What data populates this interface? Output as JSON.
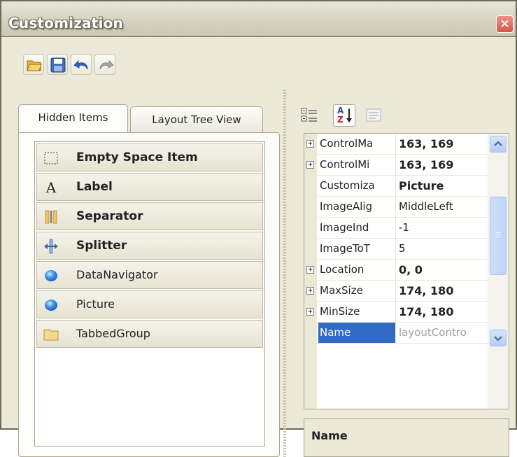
{
  "window": {
    "title": "Customization",
    "close_glyph": "×"
  },
  "toolbar": {
    "buttons": [
      {
        "name": "open-icon"
      },
      {
        "name": "save-icon"
      },
      {
        "name": "undo-icon"
      },
      {
        "name": "redo-icon"
      }
    ]
  },
  "tabs": [
    {
      "label": "Hidden Items",
      "active": true
    },
    {
      "label": "Layout Tree View",
      "active": false
    }
  ],
  "hidden_items": [
    {
      "label": "Empty Space Item",
      "icon": "empty-space-icon",
      "bold": true
    },
    {
      "label": "Label",
      "icon": "label-icon",
      "bold": true
    },
    {
      "label": "Separator",
      "icon": "separator-icon",
      "bold": true
    },
    {
      "label": "Splitter",
      "icon": "splitter-icon",
      "bold": true
    },
    {
      "label": "DataNavigator",
      "icon": "control-icon",
      "bold": false
    },
    {
      "label": "Picture",
      "icon": "control-icon",
      "bold": false
    },
    {
      "label": "TabbedGroup",
      "icon": "folder-icon",
      "bold": false
    }
  ],
  "label_glyph": "A",
  "property_toolbar": {
    "categorized": "categorized-icon",
    "alphabetical": "alphabetical-sort-icon",
    "property_pages": "property-pages-icon",
    "sort_letters_top": "A",
    "sort_letters_bottom": "Z"
  },
  "property_grid": {
    "rows": [
      {
        "name": "ControlMa",
        "value": "163, 169",
        "expandable": true,
        "bold": true
      },
      {
        "name": "ControlMi",
        "value": "163, 169",
        "expandable": true,
        "bold": true
      },
      {
        "name": "Customiza",
        "value": "Picture",
        "expandable": false,
        "bold": true
      },
      {
        "name": "ImageAlig",
        "value": "MiddleLeft",
        "expandable": false,
        "bold": false
      },
      {
        "name": "ImageInd",
        "value": "-1",
        "expandable": false,
        "bold": false
      },
      {
        "name": "ImageToT",
        "value": "5",
        "expandable": false,
        "bold": false
      },
      {
        "name": "Location",
        "value": "0, 0",
        "expandable": true,
        "bold": true
      },
      {
        "name": "MaxSize",
        "value": "174, 180",
        "expandable": true,
        "bold": true
      },
      {
        "name": "MinSize",
        "value": "174, 180",
        "expandable": true,
        "bold": true
      },
      {
        "name": "Name",
        "value": "layoutContro",
        "expandable": false,
        "bold": false,
        "selected": true
      }
    ],
    "expander_glyph": "+"
  },
  "description": {
    "title": "Name"
  },
  "colors": {
    "titlebar": "#d6d3c2",
    "client": "#ece9d8",
    "selection": "#316ac5",
    "close_button": "#d8564a"
  }
}
